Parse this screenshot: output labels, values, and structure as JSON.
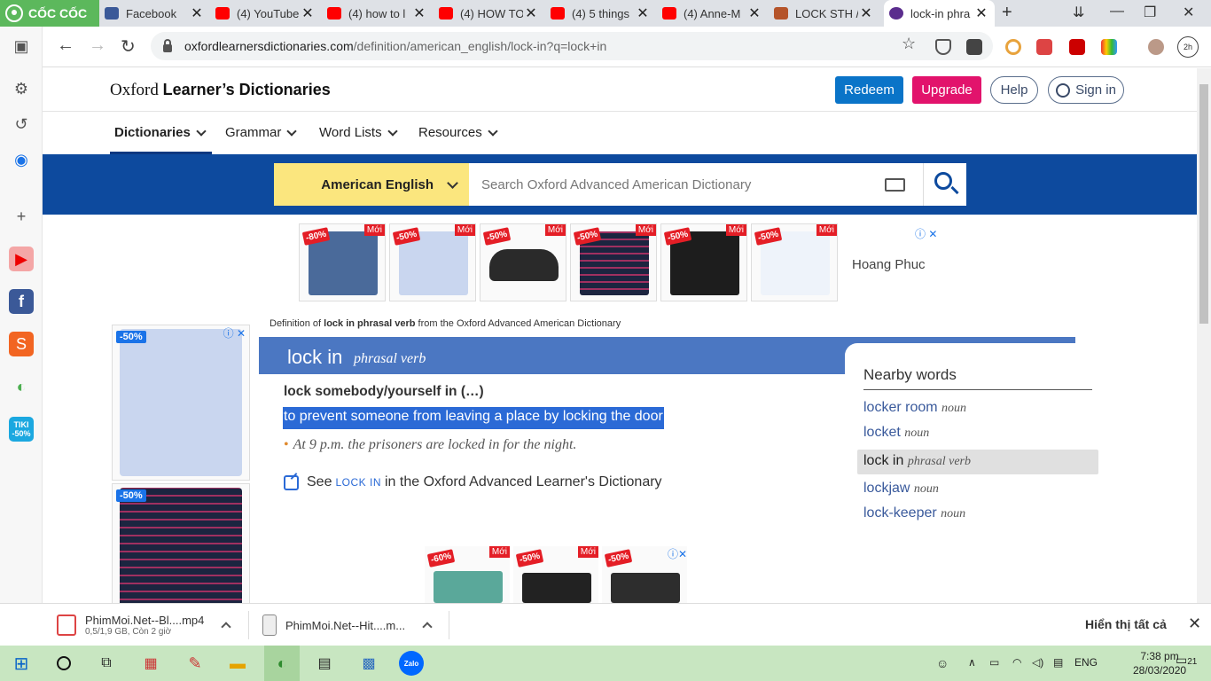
{
  "browser": {
    "brand": "CỐC CỐC",
    "tabs": [
      {
        "title": "Facebook",
        "favicon_color": "#3b5998"
      },
      {
        "title": "(4) YouTube",
        "favicon_color": "#ff0000"
      },
      {
        "title": "(4) how to l",
        "favicon_color": "#ff0000"
      },
      {
        "title": "(4) HOW TO",
        "favicon_color": "#ff0000"
      },
      {
        "title": "(4) 5 things",
        "favicon_color": "#ff0000"
      },
      {
        "title": "(4) Anne-M",
        "favicon_color": "#ff0000"
      },
      {
        "title": "LOCK STH /",
        "favicon_color": "#b5542a"
      },
      {
        "title": "lock-in phra",
        "favicon_color": "#5b2d8e"
      }
    ],
    "url": {
      "host": "oxfordlearnersdictionaries.com",
      "path": "/definition/american_english/lock-in?q=lock+in"
    },
    "profile_badge": "2h"
  },
  "site": {
    "title_serif": "Oxford",
    "title_sans": "Learner’s Dictionaries",
    "buttons": {
      "redeem": "Redeem",
      "upgrade": "Upgrade",
      "help": "Help",
      "signin": "Sign in"
    },
    "menu": [
      "Dictionaries",
      "Grammar",
      "Word Lists",
      "Resources"
    ],
    "dictionary_select": "American English",
    "search_placeholder": "Search Oxford Advanced American Dictionary"
  },
  "ads": {
    "top_tags": [
      "-80%",
      "-50%",
      "-50%",
      "-50%",
      "-50%",
      "-50%"
    ],
    "moi_label": "Mới",
    "brand": "Hoang Phuc",
    "side_tags": [
      "-50%",
      "-50%"
    ],
    "bottom_tags": [
      "-60%",
      "-50%",
      "-50%"
    ]
  },
  "entry": {
    "breadcrumb_pre": "Definition of ",
    "breadcrumb_bold": "lock in phrasal verb",
    "breadcrumb_post": " from the Oxford Advanced American Dictionary",
    "headword": "lock in",
    "pos": "phrasal verb",
    "pattern": "lock somebody/yourself in (…)",
    "definition": "to prevent someone from leaving a place by locking the door",
    "example": "At 9 p.m. the prisoners are locked in for the night.",
    "see_pre": "See",
    "see_link": "lock in",
    "see_post": "in the Oxford Advanced Learner's Dictionary"
  },
  "nearby": {
    "heading": "Nearby words",
    "words": [
      {
        "word": "locker room",
        "pos": "noun"
      },
      {
        "word": "locket",
        "pos": "noun"
      },
      {
        "word": "lock in",
        "pos": "phrasal verb",
        "current": true
      },
      {
        "word": "lockjaw",
        "pos": "noun"
      },
      {
        "word": "lock-keeper",
        "pos": "noun"
      }
    ]
  },
  "downloads": {
    "items": [
      {
        "name": "PhimMoi.Net--Bl....mp4",
        "sub": "0,5/1,9 GB, Còn 2 giờ"
      },
      {
        "name": "PhimMoi.Net--Hit....m..."
      }
    ],
    "show_all": "Hiển thị tất cả"
  },
  "taskbar": {
    "lang": "ENG",
    "time": "7:38 pm",
    "date": "28/03/2020",
    "notifications": "21"
  }
}
